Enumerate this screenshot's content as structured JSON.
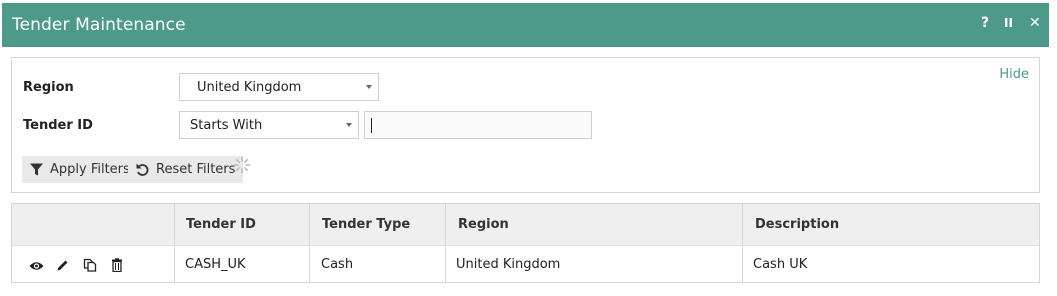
{
  "window": {
    "title": "Tender Maintenance",
    "help_label": "?",
    "pause_label": "II",
    "close_label": "✕",
    "accent_color": "#4d9a8a"
  },
  "filters": {
    "hide_label": "Hide",
    "region_label": "Region",
    "region_value": "United Kingdom",
    "tender_id_label": "Tender ID",
    "tender_id_operator": "Starts With",
    "tender_id_value": "",
    "apply_label": "Apply Filters",
    "reset_label": "Reset Filters"
  },
  "grid": {
    "columns": [
      "",
      "Tender ID",
      "Tender Type",
      "Region",
      "Description"
    ],
    "rows": [
      {
        "actions": [
          "view-icon",
          "edit-icon",
          "copy-icon",
          "delete-icon"
        ],
        "tender_id": "CASH_UK",
        "tender_type": "Cash",
        "region": "United Kingdom",
        "description": "Cash UK"
      }
    ]
  }
}
